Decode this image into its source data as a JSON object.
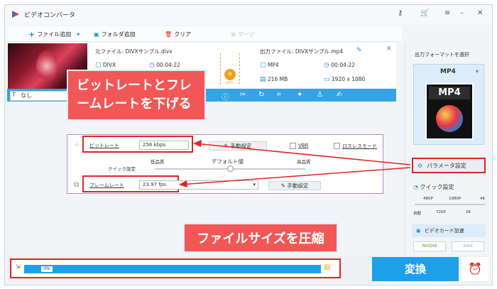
{
  "window": {
    "title": "ビデオコンバータ"
  },
  "toolbar": {
    "add_file": "ファイル追加",
    "add_folder": "フォルダ追加",
    "clear": "クリア",
    "merge": "マージ"
  },
  "file": {
    "source_label": "元ファイル: DIVXサンプル.divx",
    "src_format": "DIVX",
    "src_duration": "00:04:22",
    "output_label": "出力ファイル: DIVXサンプル.mp4",
    "out_format": "MP4",
    "out_duration": "00:04:22",
    "out_size": "216 MB",
    "out_resolution": "1920 x 1080",
    "gpu": "GPU"
  },
  "edit_bar": {
    "subtitle": "なし"
  },
  "callouts": {
    "bitrate_framerate": "ビットレートとフレームレートを下げる",
    "compress": "ファイルサイズを圧縮"
  },
  "params": {
    "bitrate_label": "ビットレート",
    "bitrate_value": "256 kbps",
    "manual_btn": "手動設定",
    "vbr": "VBR",
    "lossless": "ロスレスモード",
    "quick_setting": "クイック設定",
    "low_quality": "低品質",
    "default": "デフォルト値",
    "high_quality": "高品質",
    "framerate_label": "フレームレート",
    "framerate_value": "23.97 fps",
    "manual_btn2": "手動設定"
  },
  "right": {
    "select_format": "出力フォーマットを選択",
    "format": "MP4",
    "format_icon": "MP4",
    "param_settings": "パラメータ設定",
    "quick_setting": "クイック設定",
    "q480": "480P",
    "q1080": "1080P",
    "q4k": "4K",
    "auto": "自動",
    "q720": "720P",
    "q2k": "2K",
    "video_card": "ビデオカード加速",
    "nvidia": "NVIDIA",
    "intel": "Intel"
  },
  "bottom": {
    "progress_percent": 0,
    "progress_text": "0%",
    "convert": "変換"
  }
}
